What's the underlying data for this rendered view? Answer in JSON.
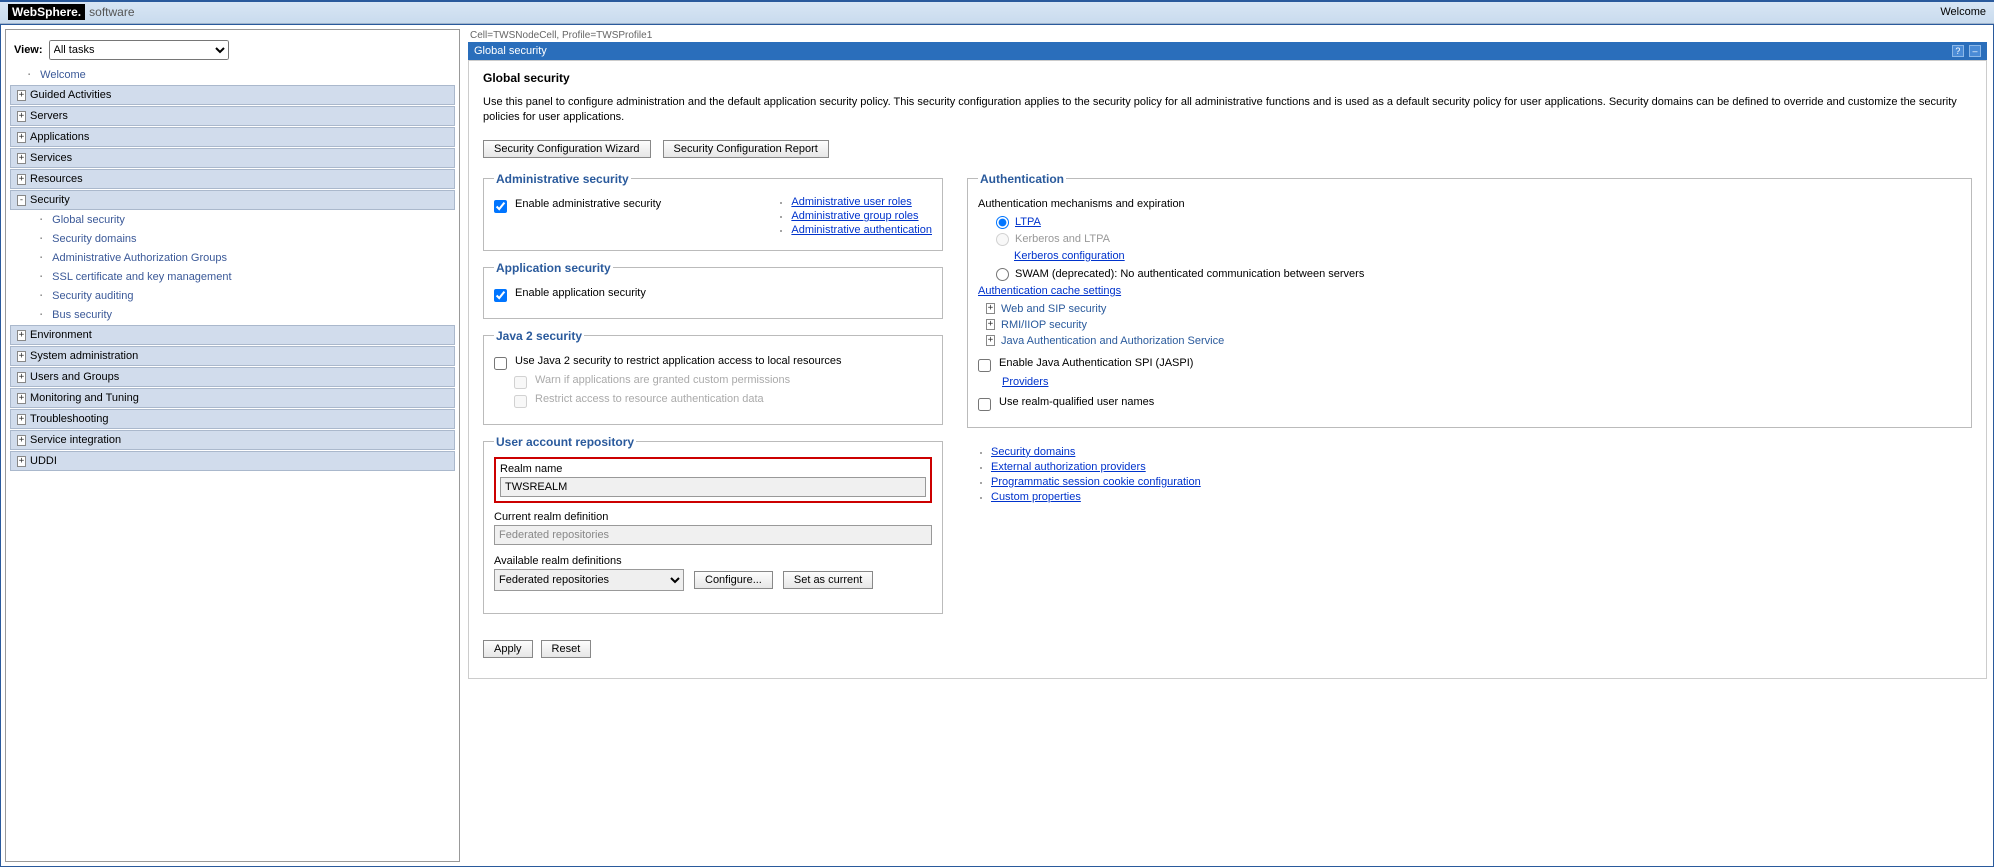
{
  "banner": {
    "logo": "WebSphere.",
    "suffix": "software",
    "welcome": "Welcome"
  },
  "sidebar": {
    "view_label": "View:",
    "view_value": "All tasks",
    "items": [
      {
        "type": "leaf",
        "label": "Welcome"
      },
      {
        "type": "branch",
        "state": "+",
        "label": "Guided Activities"
      },
      {
        "type": "branch",
        "state": "+",
        "label": "Servers"
      },
      {
        "type": "branch",
        "state": "+",
        "label": "Applications"
      },
      {
        "type": "branch",
        "state": "+",
        "label": "Services"
      },
      {
        "type": "branch",
        "state": "+",
        "label": "Resources"
      },
      {
        "type": "branch",
        "state": "-",
        "label": "Security",
        "children": [
          {
            "label": "Global security"
          },
          {
            "label": "Security domains"
          },
          {
            "label": "Administrative Authorization Groups"
          },
          {
            "label": "SSL certificate and key management"
          },
          {
            "label": "Security auditing"
          },
          {
            "label": "Bus security"
          }
        ]
      },
      {
        "type": "branch",
        "state": "+",
        "label": "Environment"
      },
      {
        "type": "branch",
        "state": "+",
        "label": "System administration"
      },
      {
        "type": "branch",
        "state": "+",
        "label": "Users and Groups"
      },
      {
        "type": "branch",
        "state": "+",
        "label": "Monitoring and Tuning"
      },
      {
        "type": "branch",
        "state": "+",
        "label": "Troubleshooting"
      },
      {
        "type": "branch",
        "state": "+",
        "label": "Service integration"
      },
      {
        "type": "branch",
        "state": "+",
        "label": "UDDI"
      }
    ]
  },
  "content": {
    "cell_info": "Cell=TWSNodeCell, Profile=TWSProfile1",
    "portlet_title": "Global security",
    "page_title": "Global security",
    "page_desc": "Use this panel to configure administration and the default application security policy. This security configuration applies to the security policy for all administrative functions and is used as a default security policy for user applications. Security domains can be defined to override and customize the security policies for user applications.",
    "btn_wizard": "Security Configuration Wizard",
    "btn_report": "Security Configuration Report",
    "admin_sec": {
      "legend": "Administrative security",
      "enable_label": "Enable administrative security",
      "links": [
        "Administrative user roles",
        "Administrative group roles",
        "Administrative authentication"
      ]
    },
    "app_sec": {
      "legend": "Application security",
      "enable_label": "Enable application security"
    },
    "java2": {
      "legend": "Java 2 security",
      "use_label": "Use Java 2 security to restrict application access to local resources",
      "warn_label": "Warn if applications are granted custom permissions",
      "restrict_label": "Restrict access to resource authentication data"
    },
    "repo": {
      "legend": "User account repository",
      "realm_label": "Realm name",
      "realm_value": "TWSREALM",
      "current_label": "Current realm definition",
      "current_value": "Federated repositories",
      "avail_label": "Available realm definitions",
      "avail_value": "Federated repositories",
      "btn_configure": "Configure...",
      "btn_setcurrent": "Set as current"
    },
    "auth": {
      "legend": "Authentication",
      "subhead": "Authentication mechanisms and expiration",
      "ltpa": "LTPA",
      "kerberos": "Kerberos and LTPA",
      "kerberos_link": "Kerberos configuration",
      "swam": "SWAM (deprecated): No authenticated communication between servers",
      "cache_link": "Authentication cache settings",
      "tree": [
        "Web and SIP security",
        "RMI/IIOP security",
        "Java Authentication and Authorization Service"
      ],
      "jaspi_label": "Enable Java Authentication SPI (JASPI)",
      "providers_link": "Providers",
      "realm_qual_label": "Use realm-qualified user names",
      "extra_links": [
        "Security domains",
        "External authorization providers",
        "Programmatic session cookie configuration",
        "Custom properties"
      ]
    },
    "btn_apply": "Apply",
    "btn_reset": "Reset"
  }
}
